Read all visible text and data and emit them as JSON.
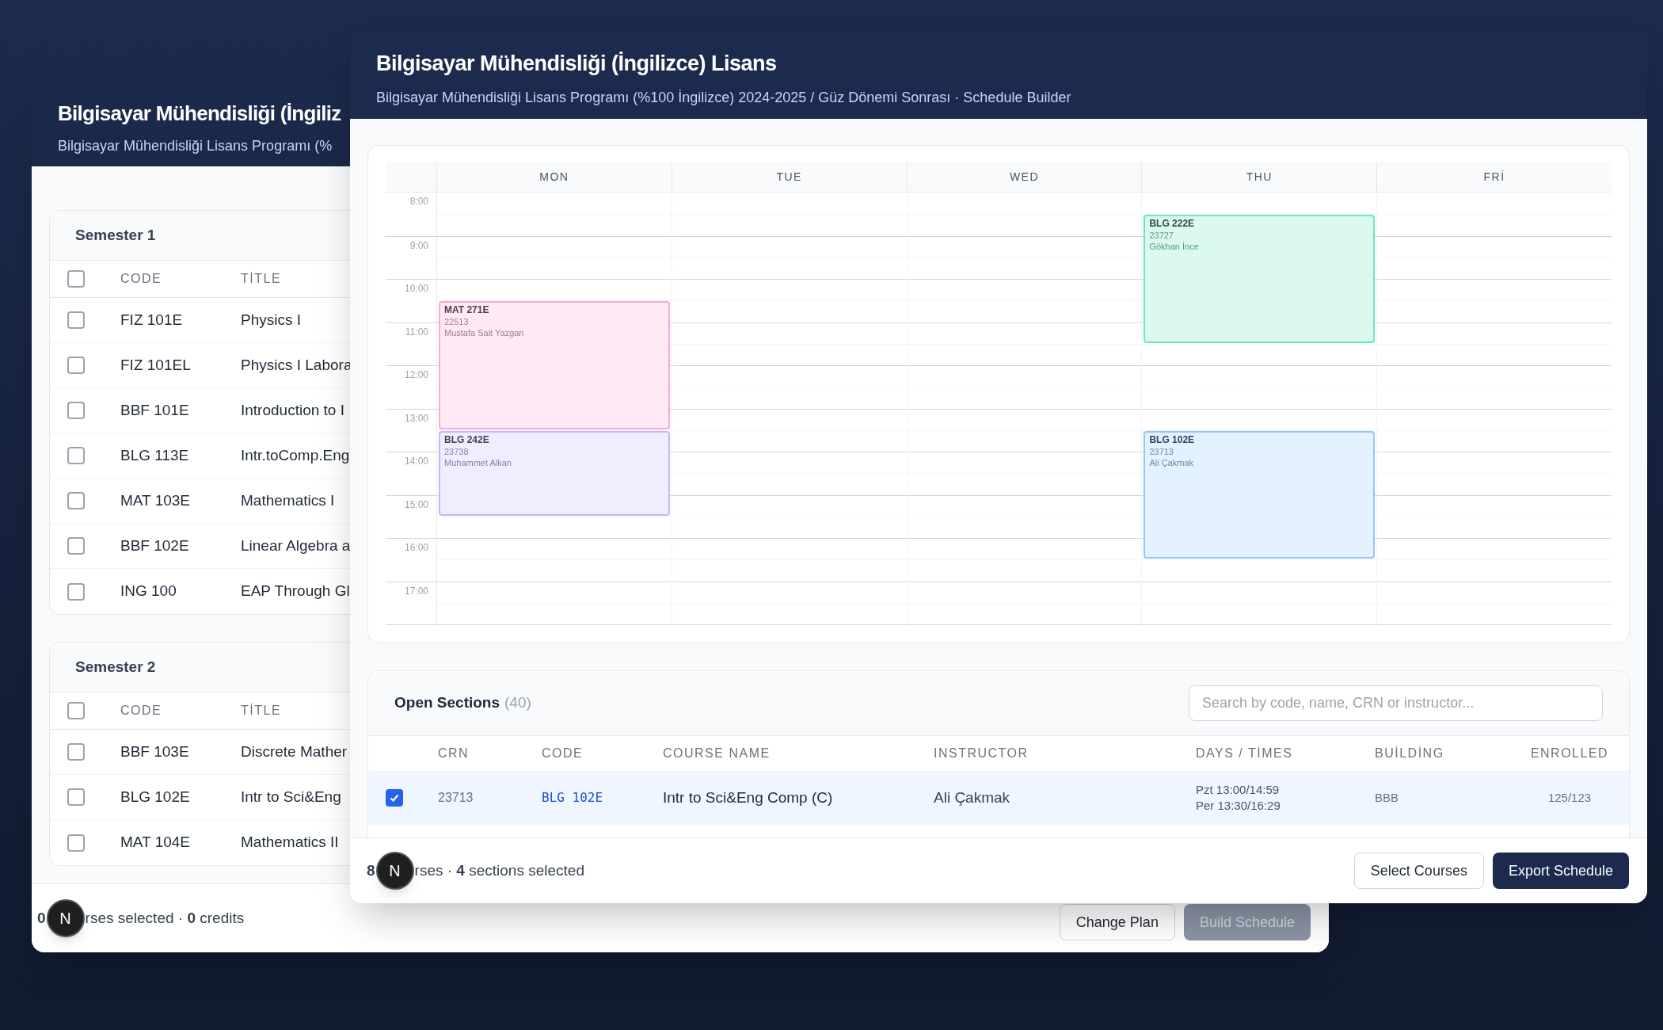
{
  "back_window": {
    "title": "Bilgisayar Mühendisliği (İngiliz",
    "subtitle": "Bilgisayar Mühendisliği Lisans Programı (%",
    "semesters": [
      {
        "title": "Semester 1",
        "select_all_checked": false,
        "columns": [
          "CODE",
          "TİTLE"
        ],
        "courses": [
          {
            "code": "FIZ 101E",
            "title": "Physics I",
            "checked": false
          },
          {
            "code": "FIZ 101EL",
            "title": "Physics I Labora",
            "checked": false
          },
          {
            "code": "BBF 101E",
            "title": "Introduction to I",
            "checked": false
          },
          {
            "code": "BLG 113E",
            "title": "Intr.toComp.Eng",
            "checked": false
          },
          {
            "code": "MAT 103E",
            "title": "Mathematics I",
            "checked": false
          },
          {
            "code": "BBF 102E",
            "title": "Linear Algebra a",
            "checked": false
          },
          {
            "code": "ING 100",
            "title": "EAP Through Gl",
            "checked": false
          }
        ]
      },
      {
        "title": "Semester 2",
        "select_all_checked": false,
        "columns": [
          "CODE",
          "TİTLE"
        ],
        "courses": [
          {
            "code": "BBF 103E",
            "title": "Discrete Mather",
            "checked": false
          },
          {
            "code": "BLG 102E",
            "title": "Intr to Sci&Eng",
            "checked": false
          },
          {
            "code": "MAT 104E",
            "title": "Mathematics II",
            "checked": false
          }
        ]
      }
    ],
    "footer": {
      "count_fragment": "0",
      "text": "rses selected · **0** credits",
      "dev_badge": "N"
    },
    "buttons": [
      {
        "label": "Change Plan",
        "kind": "outline",
        "disabled": false
      },
      {
        "label": "Build Schedule",
        "kind": "primary",
        "disabled": true
      }
    ]
  },
  "window": {
    "title": "Bilgisayar Mühendisliği (İngilizce) Lisans",
    "subtitle": "Bilgisayar Mühendisliği Lisans Programı (%100 İngilizce) 2024-2025 / Güz Dönemi Sonrası · Schedule Builder",
    "calendar": {
      "hours": [
        "8:00",
        "9:00",
        "10:00",
        "11:00",
        "12:00",
        "13:00",
        "14:00",
        "15:00",
        "16:00",
        "17:00"
      ],
      "days": [
        {
          "label": "MON",
          "events": [
            {
              "code": "MAT 271E",
              "crn": "22513",
              "instructor": "Mustafa Sait Yazgan",
              "color": "#f9a8d4"
            },
            {
              "code": "BLG 242E",
              "crn": "23738",
              "instructor": "Muhammet Alkan",
              "color": "#c4b5fd"
            }
          ]
        },
        {
          "label": "TUE"
        },
        {
          "label": "WED"
        },
        {
          "label": "THU",
          "events": [
            {
              "code": "BLG 222E",
              "crn": "23727",
              "instructor": "Gökhan İnce",
              "color": "#6ee7b7"
            },
            {
              "code": "BLG 102E",
              "crn": "23713",
              "instructor": "Ali Çakmak",
              "color": "#93c5fd"
            }
          ]
        },
        {
          "label": "FRİ"
        }
      ]
    },
    "open_sections": {
      "title": "Open Sections",
      "count": "(40)",
      "search": {
        "placeholder": "Search by code, name, CRN or instructor..."
      },
      "columns": [
        "CRN",
        "CODE",
        "COURSE NAME",
        "INSTRUCTOR",
        "DAYS / TİMES",
        "BUİLDİNG",
        "ENROLLED"
      ],
      "rows": [
        {
          "selected": true,
          "crn": "23713",
          "code": "BLG 102E",
          "course_name": "Intr to Sci&Eng Comp (C)",
          "instructor": "Ali Çakmak",
          "times": [
            "Pzt 13:00/14:59",
            "Per 13:30/16:29"
          ],
          "building": "BBB",
          "enrolled": "125/123"
        }
      ]
    },
    "footer": {
      "count_fragment": "8",
      "text": "rses · **4** sections selected",
      "dev_badge": "N"
    },
    "buttons": [
      {
        "label": "Select Courses",
        "kind": "outline",
        "disabled": false
      },
      {
        "label": "Export Schedule",
        "kind": "primary",
        "disabled": false
      }
    ]
  }
}
